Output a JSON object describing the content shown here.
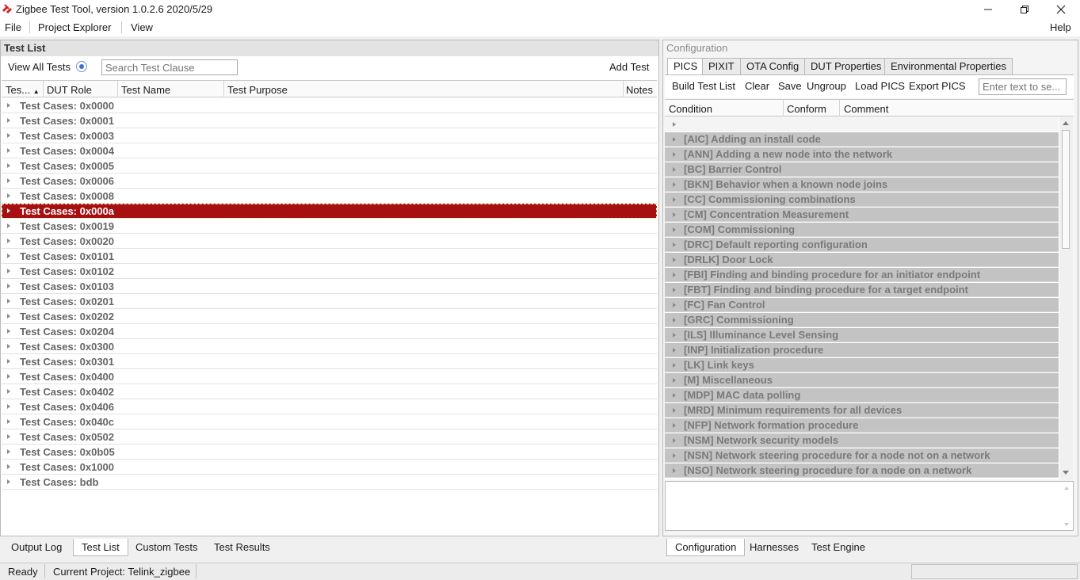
{
  "window": {
    "title": "Zigbee Test Tool, version 1.0.2.6 2020/5/29",
    "accent_color": "#a70f10"
  },
  "menu": {
    "file": "File",
    "project_explorer": "Project Explorer",
    "view": "View",
    "help": "Help"
  },
  "test_list": {
    "header": "Test List",
    "view_all_label": "View All Tests",
    "search_placeholder": "Search Test Clause",
    "add_test": "Add Test",
    "columns": [
      "Tes...",
      "DUT Role",
      "Test Name",
      "Test Purpose",
      "Notes"
    ],
    "rows": [
      "Test Cases: 0x0000",
      "Test Cases: 0x0001",
      "Test Cases: 0x0003",
      "Test Cases: 0x0004",
      "Test Cases: 0x0005",
      "Test Cases: 0x0006",
      "Test Cases: 0x0008",
      "Test Cases: 0x000a",
      "Test Cases: 0x0019",
      "Test Cases: 0x0020",
      "Test Cases: 0x0101",
      "Test Cases: 0x0102",
      "Test Cases: 0x0103",
      "Test Cases: 0x0201",
      "Test Cases: 0x0202",
      "Test Cases: 0x0204",
      "Test Cases: 0x0300",
      "Test Cases: 0x0301",
      "Test Cases: 0x0400",
      "Test Cases: 0x0402",
      "Test Cases: 0x0406",
      "Test Cases: 0x040c",
      "Test Cases: 0x0502",
      "Test Cases: 0x0b05",
      "Test Cases: 0x1000",
      "Test Cases: bdb"
    ],
    "selected_index": 7
  },
  "left_tabs": [
    "Output Log",
    "Test List",
    "Custom Tests",
    "Test Results"
  ],
  "left_active_tab": "Test List",
  "configuration": {
    "header": "Configuration",
    "tabs": [
      "PICS",
      "PIXIT",
      "OTA Config",
      "DUT Properties",
      "Environmental Properties"
    ],
    "active_tab": "PICS",
    "toolbar": [
      "Build Test List",
      "Clear",
      "Save",
      "Ungroup",
      "Load PICS",
      "Export PICS"
    ],
    "search_placeholder": "Enter text to se...",
    "columns": [
      "Condition",
      "Conform",
      "Comment"
    ],
    "rows": [
      "[AIC] Adding an install code",
      "[ANN] Adding a new node into the network",
      "[BC] Barrier Control",
      "[BKN] Behavior when a known node joins",
      "[CC] Commissioning combinations",
      "[CM] Concentration Measurement",
      "[COM] Commissioning",
      "[DRC] Default reporting configuration",
      "[DRLK] Door Lock",
      "[FBI] Finding and binding procedure for an initiator endpoint",
      "[FBT] Finding and binding procedure for a target endpoint",
      "[FC] Fan Control",
      "[GRC] Commissioning",
      "[ILS] Illuminance Level Sensing",
      "[INP] Initialization procedure",
      "[LK] Link keys",
      "[M] Miscellaneous",
      "[MDP] MAC data polling",
      "[MRD] Minimum requirements for all devices",
      "[NFP] Network formation procedure",
      "[NSM] Network security models",
      "[NSN] Network steering procedure for a node not on a network",
      "[NSO] Network steering procedure for a node on a network"
    ]
  },
  "right_tabs": [
    "Configuration",
    "Harnesses",
    "Test Engine"
  ],
  "right_active_tab": "Configuration",
  "status": {
    "ready": "Ready",
    "project": "Current Project: Telink_zigbee"
  }
}
